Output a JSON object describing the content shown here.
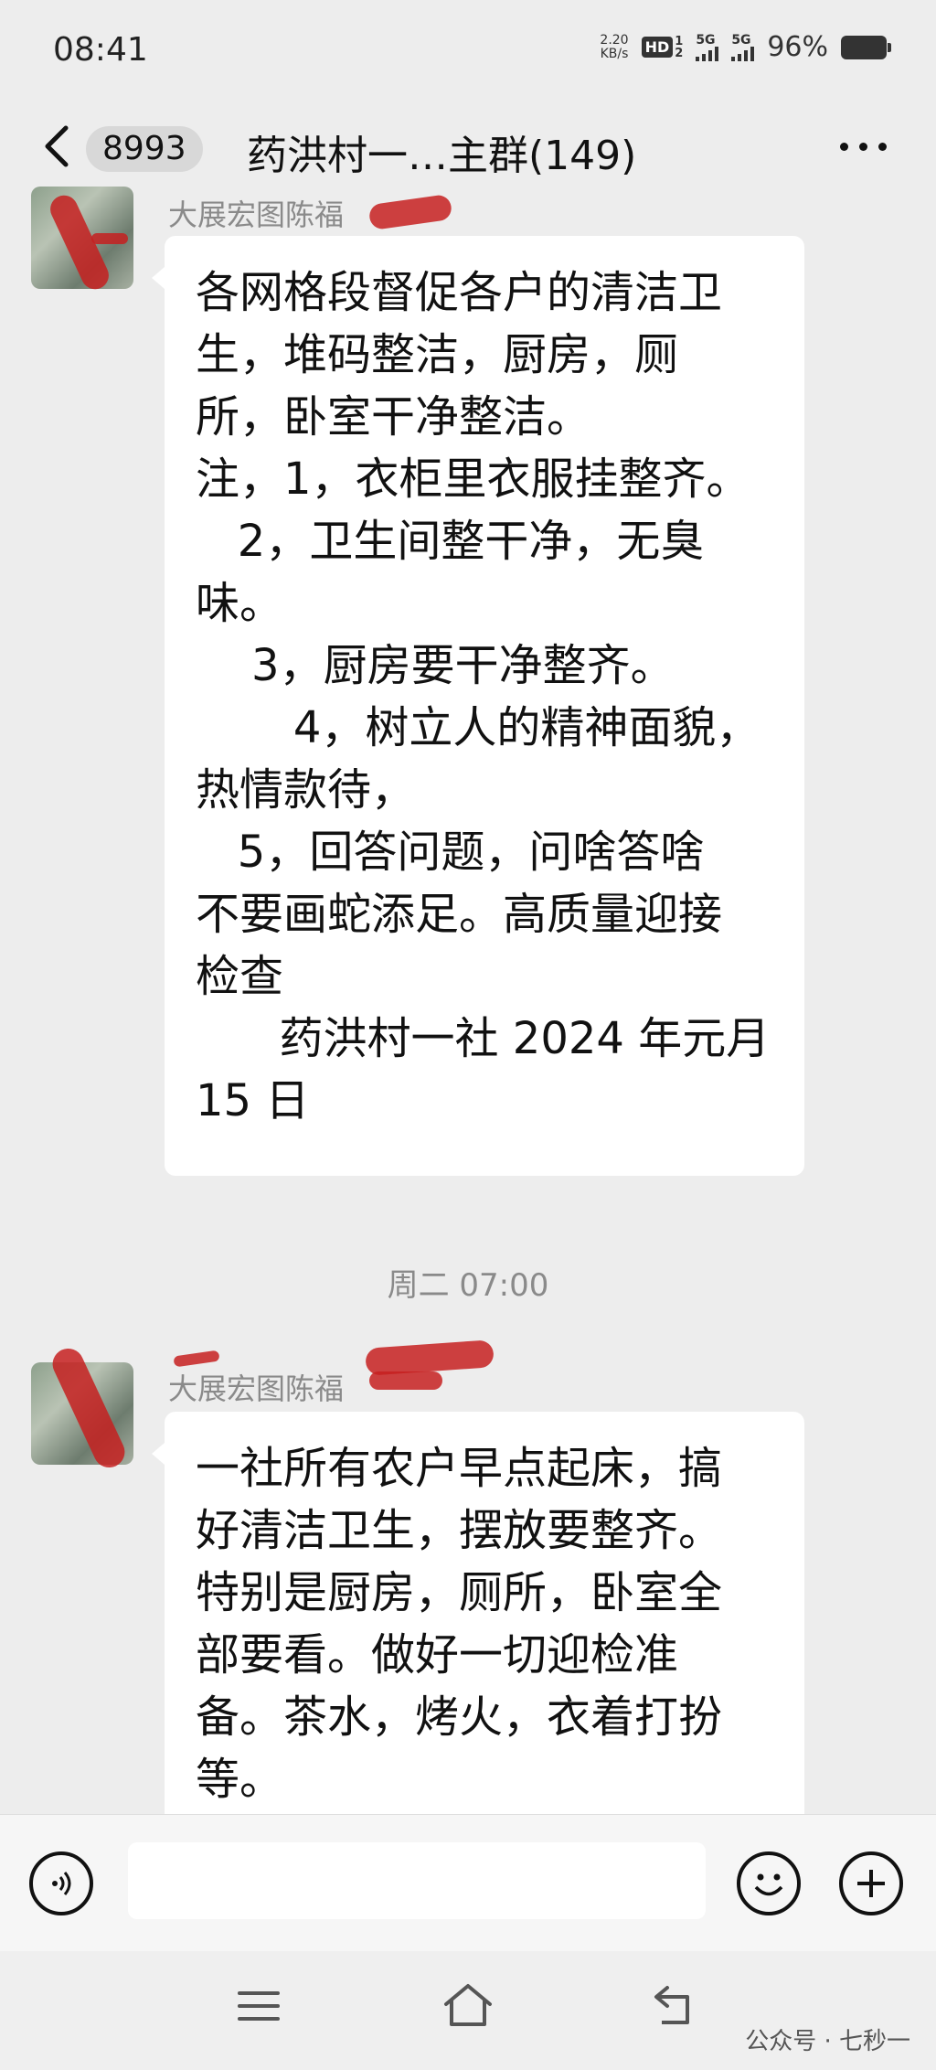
{
  "status": {
    "time": "08:41",
    "net_speed_value": "2.20",
    "net_speed_unit": "KB/s",
    "hd_label": "HD",
    "sim_a": "1",
    "sim_b": "2",
    "signal_1": "5G",
    "signal_2": "5G",
    "battery": "96%"
  },
  "header": {
    "badge": "8993",
    "title": "药洪村一…主群(149)"
  },
  "messages": [
    {
      "sender": "大展宏图陈福",
      "text": "各网格段督促各户的清洁卫\n生，堆码整洁，厨房，厕\n所，卧室干净整洁。\n注，1，衣柜里衣服挂整齐。\n   2，卫生间整干净，无臭\n味。\n    3，厨房要干净整齐。\n       4，树立人的精神面貌，\n热情款待，\n   5，回答问题，问啥答啥\n不要画蛇添足。高质量迎接\n检查\n      药洪村一社 2024 年元月\n15 日"
    },
    {
      "sender": "大展宏图陈福",
      "text": "一社所有农户早点起床，搞\n好清洁卫生，摆放要整齐。\n特别是厨房，厕所，卧室全\n部要看。做好一切迎检准\n备。茶水，烤火，衣着打扮\n等。"
    }
  ],
  "timestamp": "周二 07:00",
  "input": {
    "placeholder": ""
  },
  "watermark": "公众号 · 七秒一",
  "icons": {
    "back": "back-chevron-icon",
    "more": "more-dots-icon",
    "voice": "voice-icon",
    "emoji": "emoji-icon",
    "plus": "plus-icon",
    "menu": "menu-icon",
    "home": "home-icon",
    "return": "return-icon"
  },
  "colors": {
    "background": "#ededed",
    "bubble": "#ffffff",
    "redaction": "#c62020"
  }
}
